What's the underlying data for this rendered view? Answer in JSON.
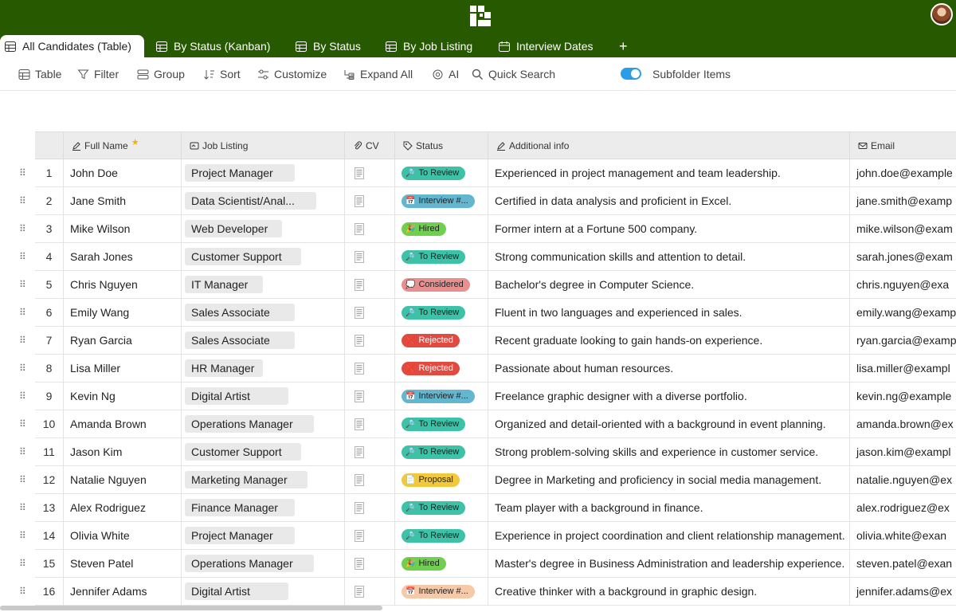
{
  "app": {
    "brand_color": "#275900"
  },
  "tabs": [
    {
      "label": "All Candidates (Table)",
      "active": true
    },
    {
      "label": "By Status (Kanban)"
    },
    {
      "label": "By Status"
    },
    {
      "label": "By Job Listing"
    },
    {
      "label": "Interview Dates"
    }
  ],
  "add_tab_label": "+",
  "toolbar": {
    "table": "Table",
    "filter": "Filter",
    "group": "Group",
    "sort": "Sort",
    "customize": "Customize",
    "expand_all": "Expand All",
    "ai": "AI",
    "quick_search": "Quick Search",
    "subfolder_items": "Subfolder Items",
    "subfolder_toggle_on": true
  },
  "columns": {
    "full_name": "Full Name",
    "job_listing": "Job Listing",
    "cv": "CV",
    "status": "Status",
    "additional_info": "Additional info",
    "email": "Email"
  },
  "status_colors": {
    "To Review": "#3cc2a6",
    "Interview #...": "#62b6cf",
    "Interview #... (peach)": "#f6c9a8",
    "Hired": "#6fcf4f",
    "Considered": "#e88f8f",
    "Rejected": "#e24a3f",
    "Proposal": "#f1c93c"
  },
  "rows": [
    {
      "n": "1",
      "name": "John Doe",
      "job": "Project Manager",
      "status": "To Review",
      "info": "Experienced in project management and team leadership.",
      "email": "john.doe@example"
    },
    {
      "n": "2",
      "name": "Jane Smith",
      "job": "Data Scientist/Anal...",
      "status": "Interview #...",
      "info": "Certified in data analysis and proficient in Excel.",
      "email": "jane.smith@examp"
    },
    {
      "n": "3",
      "name": "Mike Wilson",
      "job": "Web Developer",
      "status": "Hired",
      "info": "Former intern at a Fortune 500 company.",
      "email": "mike.wilson@exam"
    },
    {
      "n": "4",
      "name": "Sarah Jones",
      "job": "Customer Support",
      "status": "To Review",
      "info": "Strong communication skills and attention to detail.",
      "email": "sarah.jones@exam"
    },
    {
      "n": "5",
      "name": "Chris Nguyen",
      "job": "IT Manager",
      "status": "Considered",
      "info": "Bachelor's degree in Computer Science.",
      "email": "chris.nguyen@exa"
    },
    {
      "n": "6",
      "name": "Emily Wang",
      "job": "Sales Associate",
      "status": "To Review",
      "info": "Fluent in two languages and experienced in sales.",
      "email": "emily.wang@examp"
    },
    {
      "n": "7",
      "name": "Ryan Garcia",
      "job": "Sales Associate",
      "status": "Rejected",
      "info": "Recent graduate looking to gain hands-on experience.",
      "email": "ryan.garcia@examp"
    },
    {
      "n": "8",
      "name": "Lisa Miller",
      "job": "HR Manager",
      "status": "Rejected",
      "info": "Passionate about human resources.",
      "email": "lisa.miller@exampl"
    },
    {
      "n": "9",
      "name": "Kevin Ng",
      "job": "Digital Artist",
      "status": "Interview #...",
      "info": "Freelance graphic designer with a diverse portfolio.",
      "email": "kevin.ng@example"
    },
    {
      "n": "10",
      "name": "Amanda Brown",
      "job": "Operations Manager",
      "status": "To Review",
      "info": "Organized and detail-oriented with a background in event planning.",
      "email": "amanda.brown@ex"
    },
    {
      "n": "11",
      "name": "Jason Kim",
      "job": "Customer Support",
      "status": "To Review",
      "info": "Strong problem-solving skills and experience in customer service.",
      "email": "jason.kim@exampl"
    },
    {
      "n": "12",
      "name": "Natalie Nguyen",
      "job": "Marketing Manager",
      "status": "Proposal",
      "info": "Degree in Marketing and proficiency in social media management.",
      "email": "natalie.nguyen@ex"
    },
    {
      "n": "13",
      "name": "Alex Rodriguez",
      "job": "Finance Manager",
      "status": "To Review",
      "info": "Team player with a background in finance.",
      "email": "alex.rodriguez@ex"
    },
    {
      "n": "14",
      "name": "Olivia White",
      "job": "Project Manager",
      "status": "To Review",
      "info": "Experience in project coordination and client relationship management.",
      "email": "olivia.white@exan"
    },
    {
      "n": "15",
      "name": "Steven Patel",
      "job": "Operations Manager",
      "status": "Hired",
      "info": "Master's degree in Business Administration and leadership experience.",
      "email": "steven.patel@exan"
    },
    {
      "n": "16",
      "name": "Jennifer Adams",
      "job": "Digital Artist",
      "status": "Interview #...",
      "status_variant": "peach",
      "info": "Creative thinker with a background in graphic design.",
      "email": "jennifer.adams@ex"
    }
  ]
}
